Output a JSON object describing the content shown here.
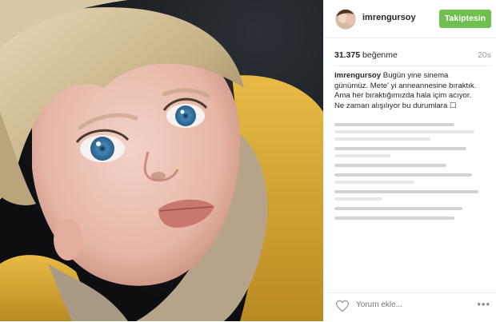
{
  "post": {
    "photo_alt": "Close-up of a blond toddler with blue eyes wearing a yellow jacket with a fleece collar",
    "header": {
      "username": "imrengursoy",
      "follow_label": "Takiptesin"
    },
    "likes": {
      "count": "31.375",
      "label": "beğenme",
      "time": "20s"
    },
    "caption": {
      "author": "imrengursoy",
      "text": "Bugün yine sinema günümüz. Mete' yi anneannesine bıraktık. Ama her bıraktığımızda hala içim acıyor. Ne zaman alışılıyor bu durumlara ☐"
    },
    "footer": {
      "comment_placeholder": "Yorum ekle...",
      "more_label": "•••"
    }
  },
  "colors": {
    "follow_button": "#70c050",
    "jacket": "#e3b43a",
    "eyes": "#4d93c4"
  }
}
